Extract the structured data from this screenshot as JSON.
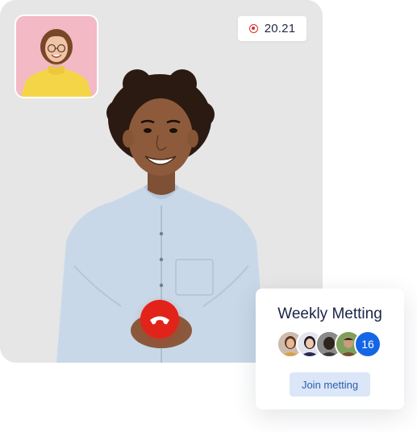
{
  "call": {
    "timer": "20.21",
    "timer_icon": "record-icon",
    "end_call_icon": "phone-hangup-icon",
    "end_call_color": "#e2231a"
  },
  "meeting_card": {
    "title": "Weekly Metting",
    "extra_participants": "16",
    "join_label": "Join metting",
    "accent": "#1566e6"
  }
}
